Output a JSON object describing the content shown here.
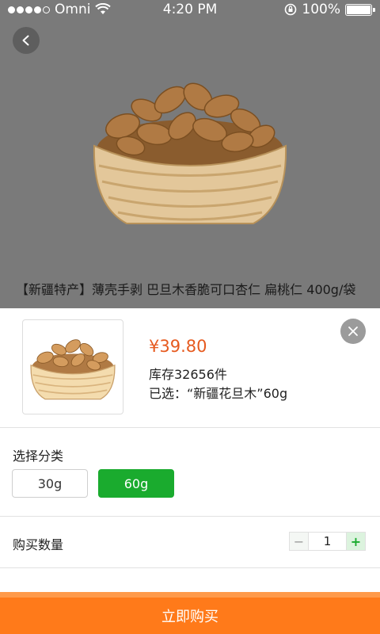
{
  "status_bar": {
    "carrier": "Omni",
    "time": "4:20 PM",
    "battery": "100%"
  },
  "product": {
    "title": "【新疆特产】薄壳手剥 巴旦木香脆可口杏仁 扁桃仁 400g/袋"
  },
  "sku_sheet": {
    "price": "¥39.80",
    "stock": "库存32656件",
    "selected": "已选：“新疆花旦木”60g",
    "category_label": "选择分类",
    "options": [
      "30g",
      "60g"
    ],
    "selected_option": "60g",
    "quantity_label": "购买数量",
    "quantity": "1",
    "minus": "−",
    "plus": "+"
  },
  "buy_button": "立即购买",
  "colors": {
    "price": "#e65a1f",
    "selected_option": "#1aab2e",
    "buy_button": "#ff7a1a"
  },
  "icons": [
    "signal-dots-icon",
    "wifi-icon",
    "rotation-lock-icon",
    "battery-icon",
    "back-icon",
    "close-icon"
  ]
}
